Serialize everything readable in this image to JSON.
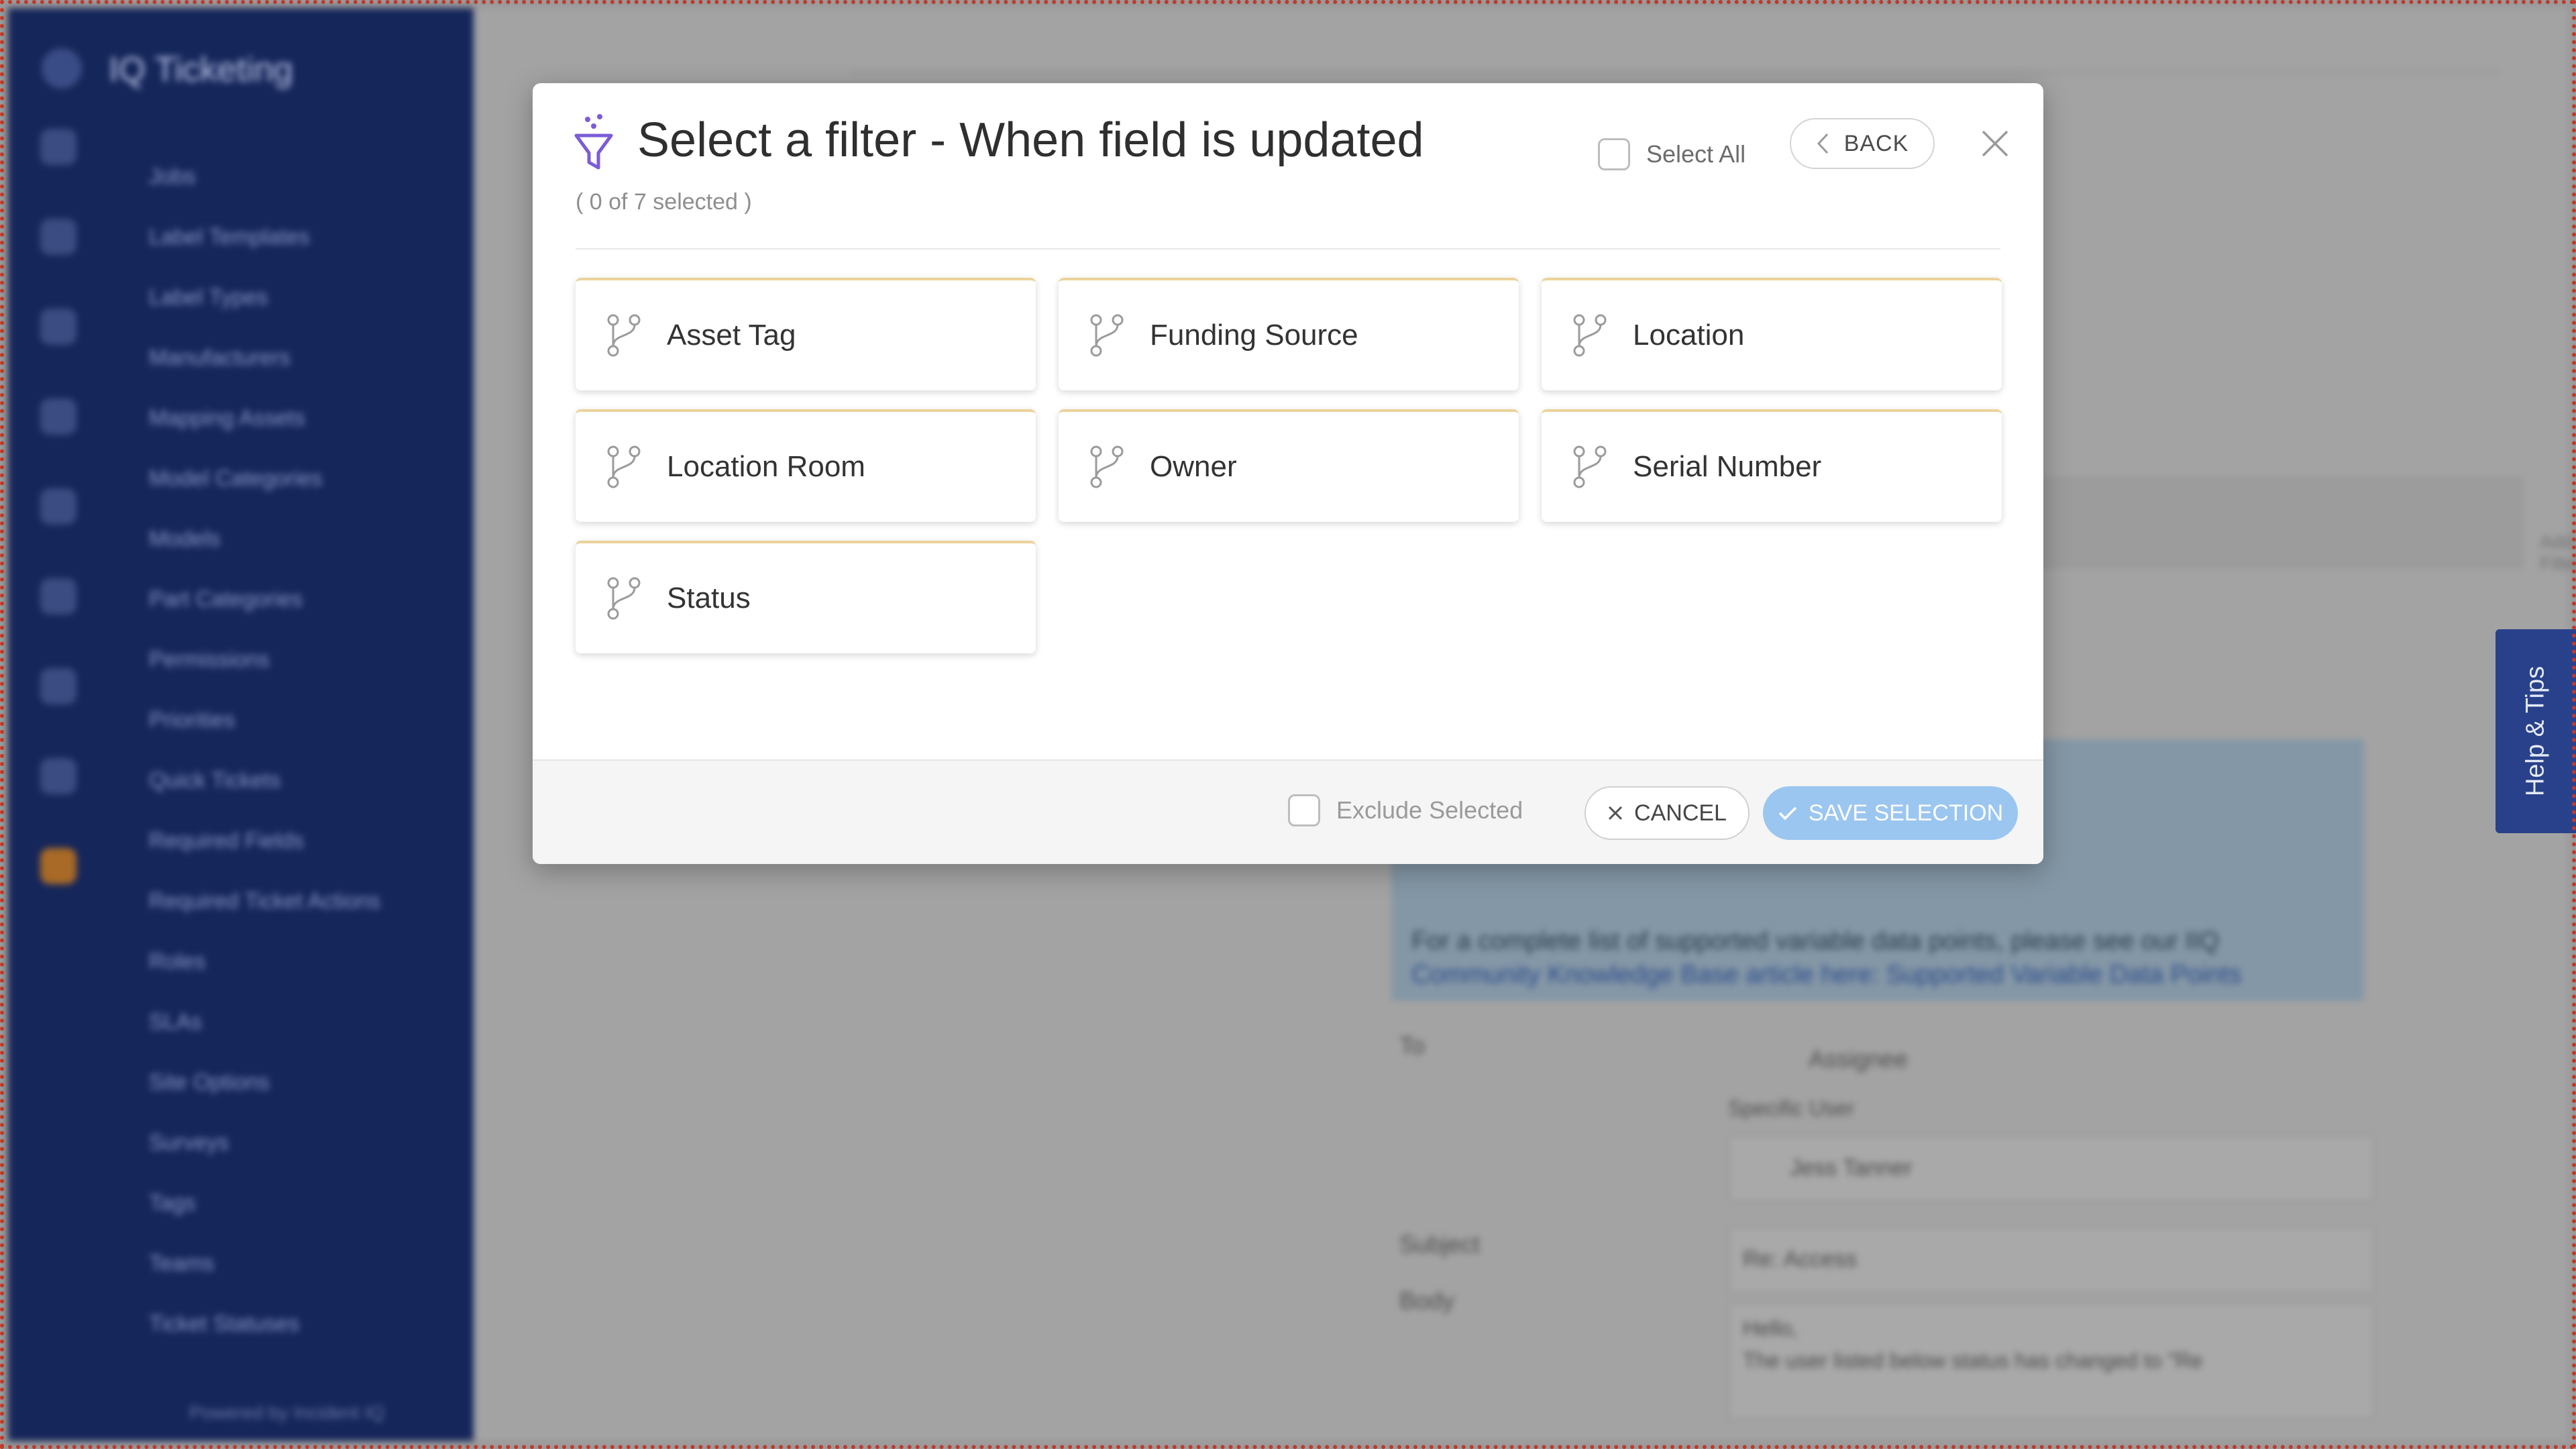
{
  "background": {
    "app_title": "IQ Ticketing",
    "nav_items": [
      "Jobs",
      "Label Templates",
      "Label Types",
      "Manufacturers",
      "Mapping Assets",
      "Model Categories",
      "Models",
      "Part Categories",
      "Permissions",
      "Priorities",
      "Quick Tickets",
      "Required Fields",
      "Required Ticket Actions",
      "Roles",
      "SLAs",
      "Site Options",
      "Surveys",
      "Tags",
      "Teams",
      "Ticket Statuses"
    ],
    "powered_by": "Powered by Incident IQ",
    "add_filter": "Add Filter",
    "info_line1": "For a complete list of supported variable data points, please see our IIQ",
    "info_line2": "Community Knowledge Base article here: Supported Variable Data Points",
    "labels": {
      "to": "To",
      "subject": "Subject",
      "body": "Body"
    },
    "assignee": "Assignee",
    "specific_user": "Specific User",
    "user_name": "Jess Tanner",
    "subject_value": "Re: Access",
    "body_line1": "Hello,",
    "body_line2": "The user listed below status has changed to \"Re"
  },
  "help_tab": "Help & Tips",
  "modal": {
    "title": "Select a filter - When field is updated",
    "selected_count": "( 0 of 7 selected )",
    "select_all_label": "Select All",
    "back_label": "BACK",
    "options": [
      {
        "label": "Asset Tag"
      },
      {
        "label": "Funding Source"
      },
      {
        "label": "Location"
      },
      {
        "label": "Location Room"
      },
      {
        "label": "Owner"
      },
      {
        "label": "Serial Number"
      },
      {
        "label": "Status"
      }
    ],
    "footer": {
      "exclude_label": "Exclude Selected",
      "cancel_label": "CANCEL",
      "save_label": "SAVE SELECTION"
    }
  },
  "colors": {
    "sidebar": "#15265a",
    "accent_primary": "#9bc6f0",
    "card_top_border": "#ecd39b",
    "funnel_icon": "#7b5cd6",
    "help_tab": "#28418a"
  },
  "icons": {
    "title": "funnel-icon",
    "option": "branch-icon",
    "back": "chevron-left-icon",
    "close": "close-icon",
    "cancel": "x-icon",
    "save": "check-icon"
  }
}
